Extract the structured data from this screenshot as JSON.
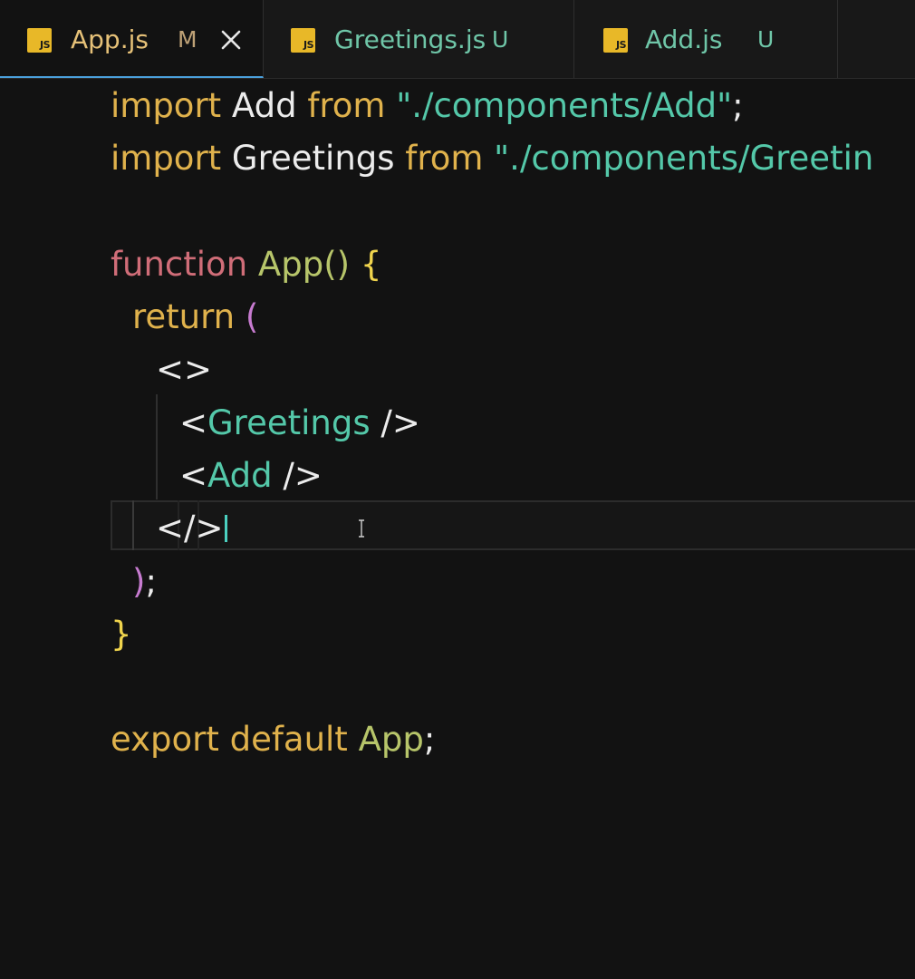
{
  "tabs": [
    {
      "filename": "App.js",
      "status": "M",
      "icon": "js-file-icon",
      "active": true,
      "has_close": true
    },
    {
      "filename": "Greetings.js",
      "status": "U",
      "icon": "js-file-icon",
      "active": false
    },
    {
      "filename": "Add.js",
      "status": "U",
      "icon": "js-file-icon",
      "active": false
    }
  ],
  "js_icon_text": "JS",
  "code": {
    "l1": {
      "kw": "import",
      "name": " Add ",
      "from": "from",
      "str": " \"./components/Add\"",
      "end": ";"
    },
    "l2": {
      "kw": "import",
      "name": " Greetings ",
      "from": "from",
      "str": " \"./components/Greetin"
    },
    "l4": {
      "kw": "function",
      "name": " App()",
      "brace": " {"
    },
    "l5": {
      "kw": "return",
      "paren": " ("
    },
    "l6": {
      "text": "<>"
    },
    "l7": {
      "open": "<",
      "comp": "Greetings",
      "close": " />"
    },
    "l8": {
      "open": "<",
      "comp": "Add",
      "close": " />"
    },
    "l9": {
      "text": "</>"
    },
    "l10": {
      "paren": ")",
      "end": ";"
    },
    "l11": {
      "brace": "}"
    },
    "l13": {
      "kw": "export",
      "kw2": " default",
      "name": " App",
      "end": ";"
    }
  },
  "colors": {
    "keyword": "#e0b24c",
    "function_keyword": "#d06d78",
    "string": "#54c8a9",
    "active_tab_border": "#4a9fdb"
  }
}
